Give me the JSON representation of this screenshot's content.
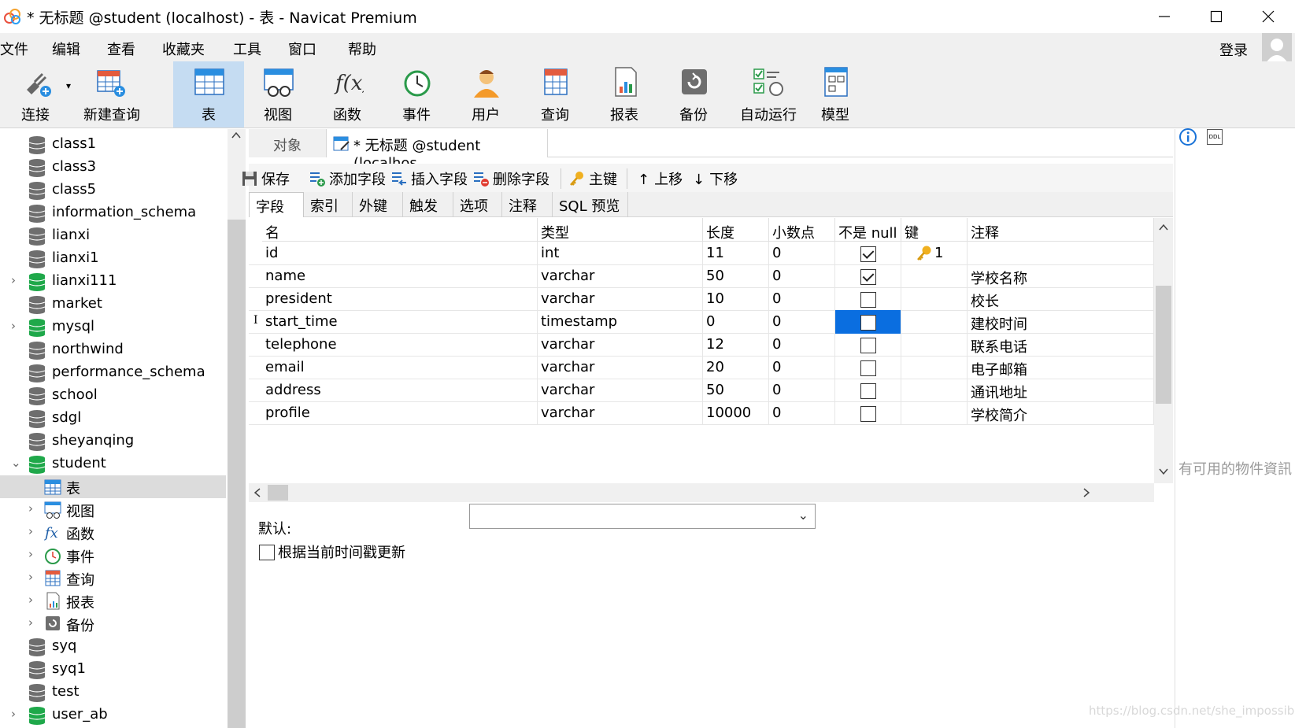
{
  "window": {
    "title": "* 无标题 @student (localhost) - 表 - Navicat Premium"
  },
  "menu": {
    "items": [
      "文件",
      "编辑",
      "查看",
      "收藏夹",
      "工具",
      "窗口",
      "帮助"
    ],
    "login_label": "登录"
  },
  "toolbar": {
    "buttons": [
      {
        "label": "连接",
        "icon": "plug-icon"
      },
      {
        "label": "新建查询",
        "icon": "new-query-icon"
      },
      {
        "label": "表",
        "icon": "table-icon",
        "active": true
      },
      {
        "label": "视图",
        "icon": "view-icon"
      },
      {
        "label": "函数",
        "icon": "function-icon"
      },
      {
        "label": "事件",
        "icon": "clock-icon"
      },
      {
        "label": "用户",
        "icon": "user-icon"
      },
      {
        "label": "查询",
        "icon": "query-icon"
      },
      {
        "label": "报表",
        "icon": "report-icon"
      },
      {
        "label": "备份",
        "icon": "backup-icon"
      },
      {
        "label": "自动运行",
        "icon": "schedule-icon"
      },
      {
        "label": "模型",
        "icon": "model-icon"
      }
    ]
  },
  "tree": {
    "items": [
      {
        "label": "class1",
        "type": "db"
      },
      {
        "label": "class3",
        "type": "db"
      },
      {
        "label": "class5",
        "type": "db"
      },
      {
        "label": "information_schema",
        "type": "db"
      },
      {
        "label": "lianxi",
        "type": "db"
      },
      {
        "label": "lianxi1",
        "type": "db"
      },
      {
        "label": "lianxi111",
        "type": "db-open"
      },
      {
        "label": "market",
        "type": "db"
      },
      {
        "label": "mysql",
        "type": "db-open"
      },
      {
        "label": "northwind",
        "type": "db"
      },
      {
        "label": "performance_schema",
        "type": "db"
      },
      {
        "label": "school",
        "type": "db"
      },
      {
        "label": "sdgl",
        "type": "db"
      },
      {
        "label": "sheyanqing",
        "type": "db"
      },
      {
        "label": "student",
        "type": "db-expanded"
      },
      {
        "label": "表",
        "type": "child-table"
      },
      {
        "label": "视图",
        "type": "child-view"
      },
      {
        "label": "函数",
        "type": "child-function"
      },
      {
        "label": "事件",
        "type": "child-event"
      },
      {
        "label": "查询",
        "type": "child-query"
      },
      {
        "label": "报表",
        "type": "child-report"
      },
      {
        "label": "备份",
        "type": "child-backup"
      },
      {
        "label": "syq",
        "type": "db"
      },
      {
        "label": "syq1",
        "type": "db"
      },
      {
        "label": "test",
        "type": "db"
      },
      {
        "label": "user_ab",
        "type": "db-open"
      }
    ]
  },
  "doc_tabs": {
    "objects": "对象",
    "active": "* 无标题 @student (localhos..."
  },
  "actions": {
    "save": "保存",
    "add_field": "添加字段",
    "insert_field": "插入字段",
    "delete_field": "删除字段",
    "primary_key": "主键",
    "move_up": "上移",
    "move_down": "下移"
  },
  "subtabs": [
    "字段",
    "索引",
    "外键",
    "触发器",
    "选项",
    "注释",
    "SQL 预览"
  ],
  "grid": {
    "headers": [
      "名",
      "类型",
      "长度",
      "小数点",
      "不是 null",
      "键",
      "注释"
    ],
    "rows": [
      {
        "name": "id",
        "type": "int",
        "length": "11",
        "decimals": "0",
        "not_null": true,
        "key": "1",
        "comment": ""
      },
      {
        "name": "name",
        "type": "varchar",
        "length": "50",
        "decimals": "0",
        "not_null": true,
        "key": "",
        "comment": "学校名称"
      },
      {
        "name": "president",
        "type": "varchar",
        "length": "10",
        "decimals": "0",
        "not_null": false,
        "key": "",
        "comment": "校长"
      },
      {
        "name": "start_time",
        "type": "timestamp",
        "length": "0",
        "decimals": "0",
        "not_null": false,
        "key": "",
        "comment": "建校时间",
        "selected": true
      },
      {
        "name": "telephone",
        "type": "varchar",
        "length": "12",
        "decimals": "0",
        "not_null": false,
        "key": "",
        "comment": "联系电话"
      },
      {
        "name": "email",
        "type": "varchar",
        "length": "20",
        "decimals": "0",
        "not_null": false,
        "key": "",
        "comment": "电子邮箱"
      },
      {
        "name": "address",
        "type": "varchar",
        "length": "50",
        "decimals": "0",
        "not_null": false,
        "key": "",
        "comment": "通讯地址"
      },
      {
        "name": "profile",
        "type": "varchar",
        "length": "10000",
        "decimals": "0",
        "not_null": false,
        "key": "",
        "comment": "学校简介"
      }
    ]
  },
  "props": {
    "default_label": "默认:",
    "default_value": "",
    "update_on_timestamp": "根据当前时间戳更新"
  },
  "right_panel": {
    "no_info": "有可用的物件資訊",
    "ddl_label": "DDL",
    "watermark": "https://blog.csdn.net/she_impossible"
  },
  "colors": {
    "accent": "#0a6ee0",
    "toolbar_active": "#c5dcf2",
    "db_green": "#1fa84a",
    "db_gray": "#6e6e6e"
  }
}
